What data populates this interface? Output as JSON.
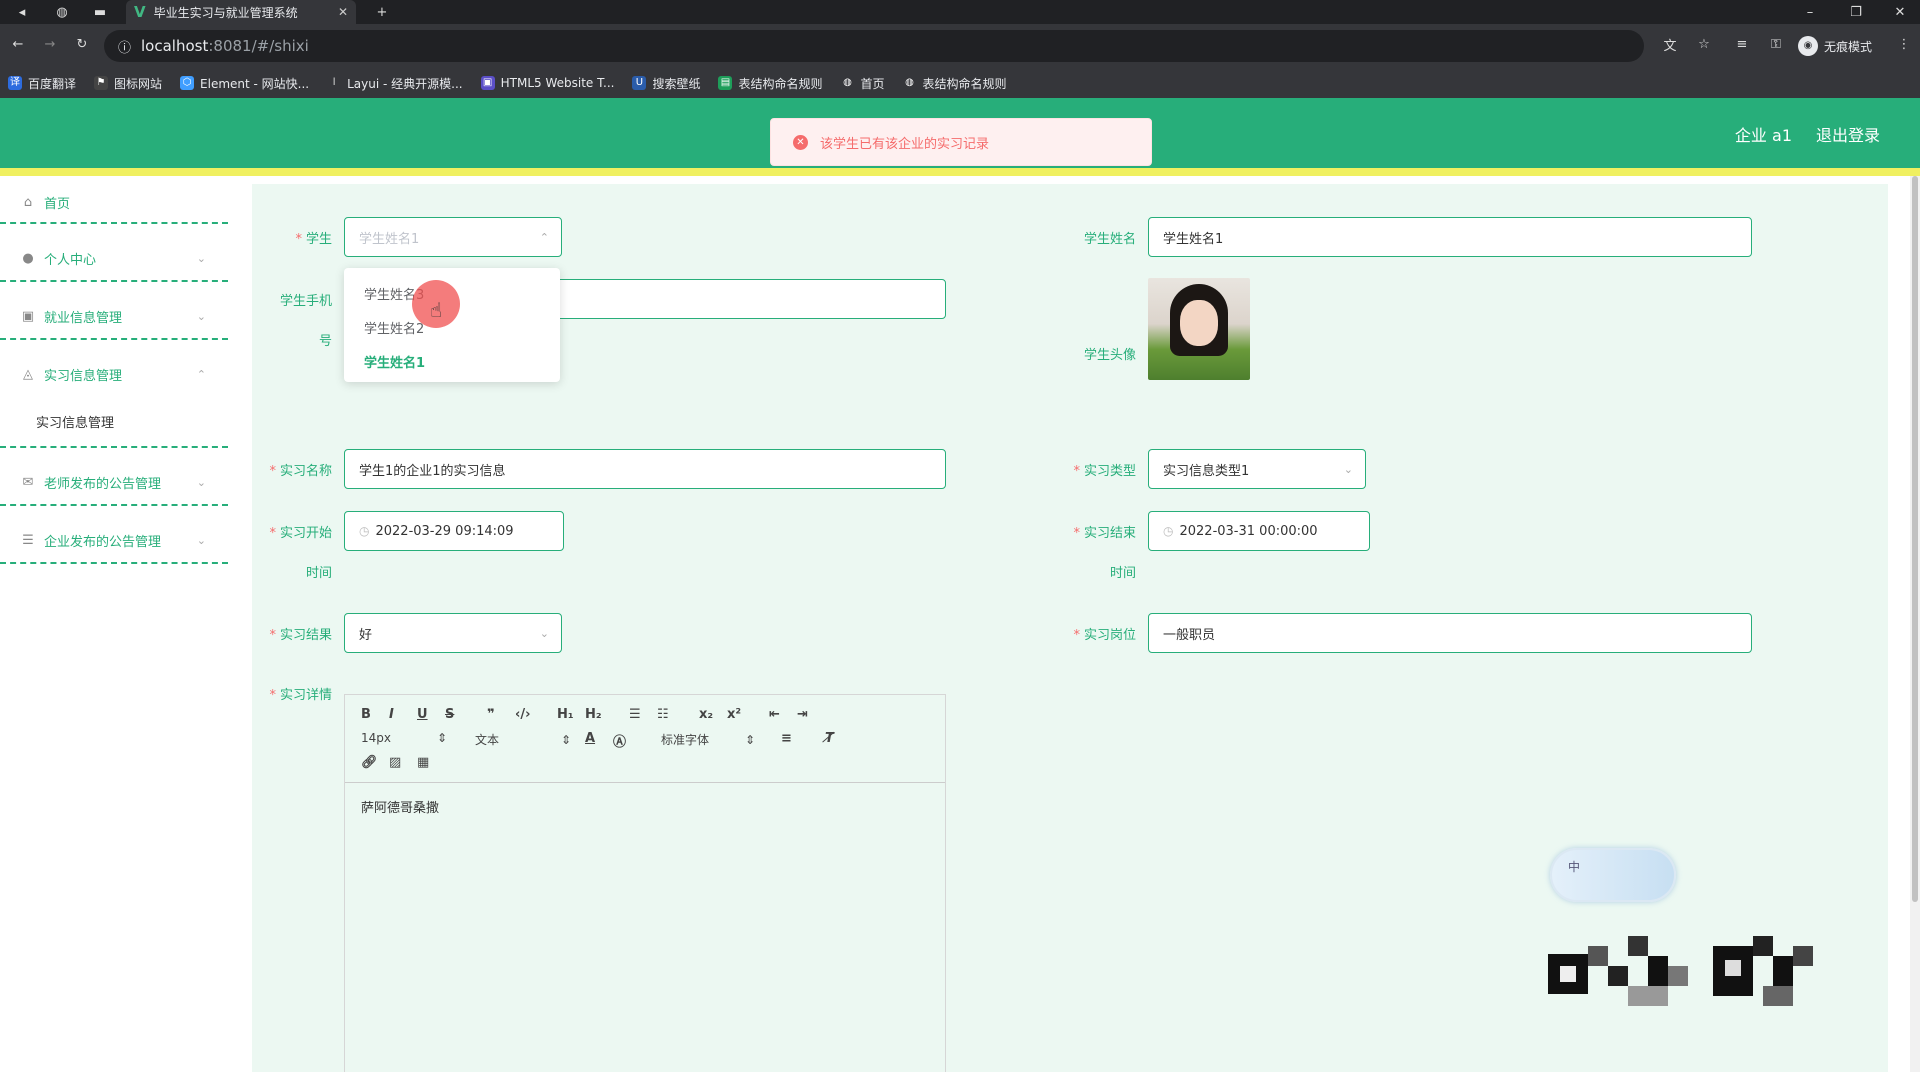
{
  "browser": {
    "tab_title": "毕业生实习与就业管理系统",
    "url_host": "localhost",
    "url_path": ":8081/#/shixi",
    "incognito_label": "无痕模式",
    "bookmarks": [
      "百度翻译",
      "图标网站",
      "Element - 网站快...",
      "Layui - 经典开源模...",
      "HTML5 Website T...",
      "搜索壁纸",
      "表结构命名规则",
      "首页",
      "表结构命名规则"
    ]
  },
  "header": {
    "user": "企业 a1",
    "logout": "退出登录",
    "toast": "该学生已有该企业的实习记录"
  },
  "sidebar": {
    "items": [
      {
        "label": "首页",
        "icon": "home-icon"
      },
      {
        "label": "个人中心",
        "icon": "user-icon"
      },
      {
        "label": "就业信息管理",
        "icon": "clipboard-icon"
      },
      {
        "label": "实习信息管理",
        "icon": "bell-icon"
      },
      {
        "label": "老师发布的公告管理",
        "icon": "mail-icon"
      },
      {
        "label": "企业发布的公告管理",
        "icon": "sliders-icon"
      }
    ],
    "sub_item": "实习信息管理"
  },
  "form": {
    "student_label": "学生",
    "student_placeholder": "学生姓名1",
    "student_options": [
      "学生姓名3",
      "学生姓名2",
      "学生姓名1"
    ],
    "phone_label_1": "学生手机",
    "phone_label_2": "号",
    "student_name_label": "学生姓名",
    "student_name_value": "学生姓名1",
    "avatar_label": "学生头像",
    "intern_name_label": "实习名称",
    "intern_name_value": "学生1的企业1的实习信息",
    "intern_type_label": "实习类型",
    "intern_type_value": "实习信息类型1",
    "start_label_1": "实习开始",
    "start_label_2": "时间",
    "start_value": "2022-03-29 09:14:09",
    "end_label_1": "实习结束",
    "end_label_2": "时间",
    "end_value": "2022-03-31 00:00:00",
    "result_label": "实习结果",
    "result_value": "好",
    "position_label": "实习岗位",
    "position_value": "一般职员",
    "detail_label": "实习详情"
  },
  "editor": {
    "font_size": "14px",
    "text_type": "文本",
    "font_family": "标准字体",
    "content": "萨阿德哥桑撒"
  },
  "ime": {
    "label": "中"
  }
}
